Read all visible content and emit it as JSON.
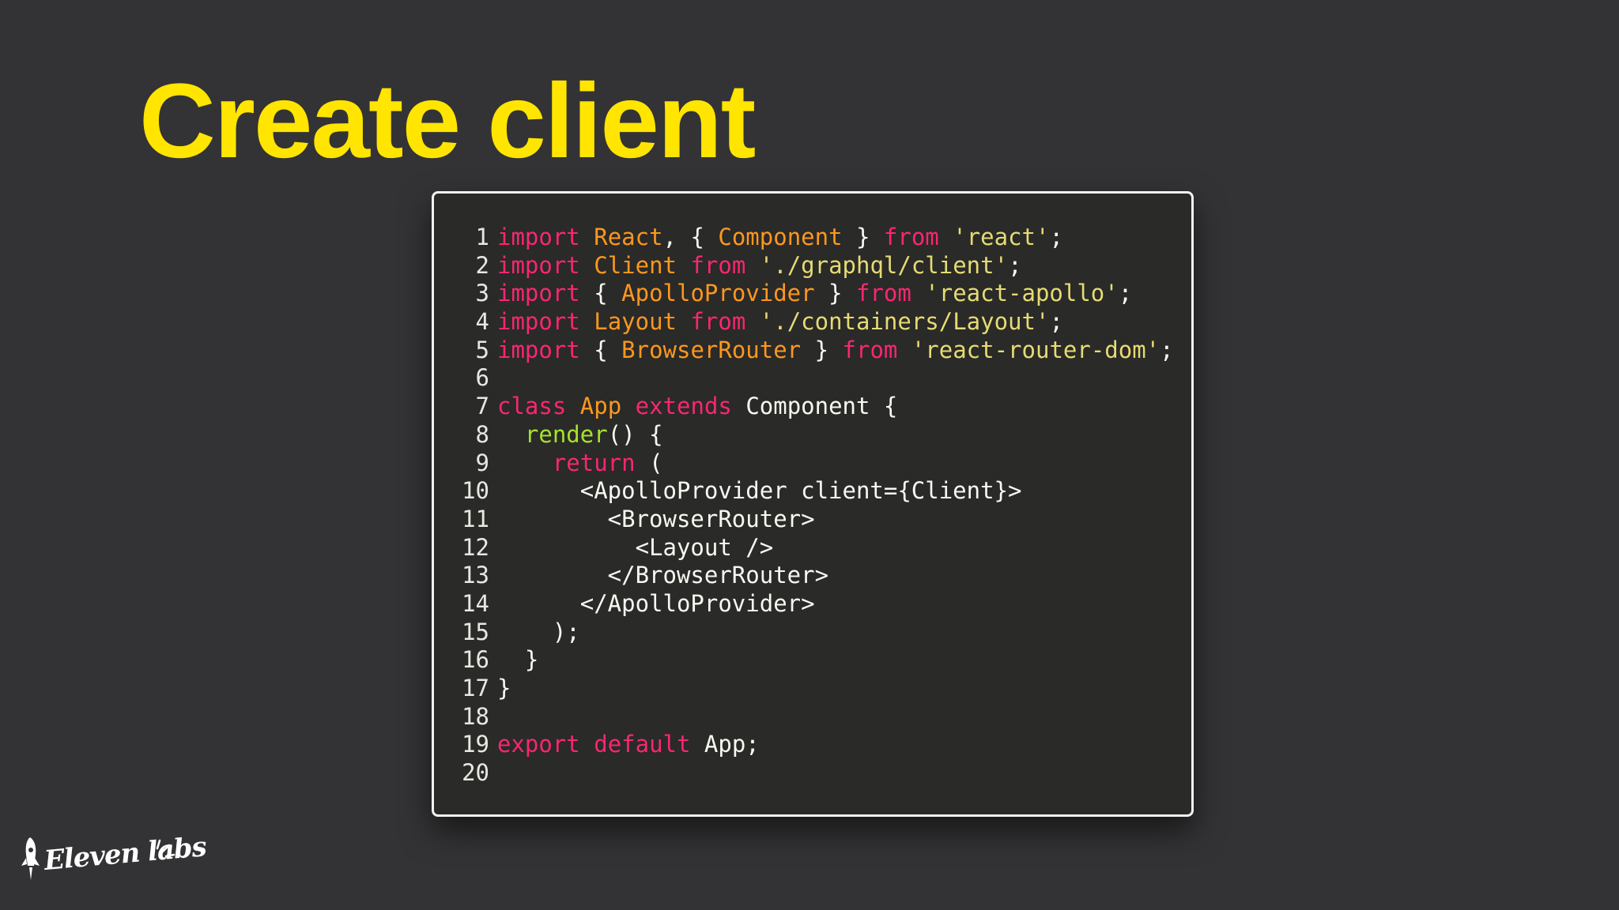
{
  "slide": {
    "title": "Create client"
  },
  "code": {
    "lines": [
      [
        {
          "t": "import",
          "c": "kw"
        },
        {
          "t": " ",
          "c": "plain"
        },
        {
          "t": "React",
          "c": "cls"
        },
        {
          "t": ", { ",
          "c": "plain"
        },
        {
          "t": "Component",
          "c": "cls"
        },
        {
          "t": " } ",
          "c": "plain"
        },
        {
          "t": "from",
          "c": "kw"
        },
        {
          "t": " ",
          "c": "plain"
        },
        {
          "t": "'react'",
          "c": "str"
        },
        {
          "t": ";",
          "c": "plain"
        }
      ],
      [
        {
          "t": "import",
          "c": "kw"
        },
        {
          "t": " ",
          "c": "plain"
        },
        {
          "t": "Client",
          "c": "cls"
        },
        {
          "t": " ",
          "c": "plain"
        },
        {
          "t": "from",
          "c": "kw"
        },
        {
          "t": " ",
          "c": "plain"
        },
        {
          "t": "'./graphql/client'",
          "c": "str"
        },
        {
          "t": ";",
          "c": "plain"
        }
      ],
      [
        {
          "t": "import",
          "c": "kw"
        },
        {
          "t": " { ",
          "c": "plain"
        },
        {
          "t": "ApolloProvider",
          "c": "cls"
        },
        {
          "t": " } ",
          "c": "plain"
        },
        {
          "t": "from",
          "c": "kw"
        },
        {
          "t": " ",
          "c": "plain"
        },
        {
          "t": "'react-apollo'",
          "c": "str"
        },
        {
          "t": ";",
          "c": "plain"
        }
      ],
      [
        {
          "t": "import",
          "c": "kw"
        },
        {
          "t": " ",
          "c": "plain"
        },
        {
          "t": "Layout",
          "c": "cls"
        },
        {
          "t": " ",
          "c": "plain"
        },
        {
          "t": "from",
          "c": "kw"
        },
        {
          "t": " ",
          "c": "plain"
        },
        {
          "t": "'./containers/Layout'",
          "c": "str"
        },
        {
          "t": ";",
          "c": "plain"
        }
      ],
      [
        {
          "t": "import",
          "c": "kw"
        },
        {
          "t": " { ",
          "c": "plain"
        },
        {
          "t": "BrowserRouter",
          "c": "cls"
        },
        {
          "t": " } ",
          "c": "plain"
        },
        {
          "t": "from",
          "c": "kw"
        },
        {
          "t": " ",
          "c": "plain"
        },
        {
          "t": "'react-router-dom'",
          "c": "str"
        },
        {
          "t": ";",
          "c": "plain"
        }
      ],
      [],
      [
        {
          "t": "class",
          "c": "kw"
        },
        {
          "t": " ",
          "c": "plain"
        },
        {
          "t": "App",
          "c": "cls"
        },
        {
          "t": " ",
          "c": "plain"
        },
        {
          "t": "extends",
          "c": "kw"
        },
        {
          "t": " Component {",
          "c": "plain"
        }
      ],
      [
        {
          "t": "  ",
          "c": "plain"
        },
        {
          "t": "render",
          "c": "fn"
        },
        {
          "t": "() {",
          "c": "plain"
        }
      ],
      [
        {
          "t": "    ",
          "c": "plain"
        },
        {
          "t": "return",
          "c": "kw"
        },
        {
          "t": " (",
          "c": "plain"
        }
      ],
      [
        {
          "t": "      <ApolloProvider client={Client}>",
          "c": "plain"
        }
      ],
      [
        {
          "t": "        <BrowserRouter>",
          "c": "plain"
        }
      ],
      [
        {
          "t": "          <Layout />",
          "c": "plain"
        }
      ],
      [
        {
          "t": "        </BrowserRouter>",
          "c": "plain"
        }
      ],
      [
        {
          "t": "      </ApolloProvider>",
          "c": "plain"
        }
      ],
      [
        {
          "t": "    );",
          "c": "plain"
        }
      ],
      [
        {
          "t": "  }",
          "c": "plain"
        }
      ],
      [
        {
          "t": "}",
          "c": "plain"
        }
      ],
      [],
      [
        {
          "t": "export",
          "c": "kw"
        },
        {
          "t": " ",
          "c": "plain"
        },
        {
          "t": "default",
          "c": "kw"
        },
        {
          "t": " App;",
          "c": "plain"
        }
      ],
      []
    ]
  },
  "logo": {
    "text": "Eleven labs",
    "icon": "rocket-icon"
  },
  "colors": {
    "background": "#333335",
    "title": "#FFE500",
    "code_background": "#2a2a28",
    "keyword": "#f92672",
    "class_name": "#fd971f",
    "string": "#e6db74",
    "function": "#a6e22e",
    "text": "#f8f8f2"
  }
}
